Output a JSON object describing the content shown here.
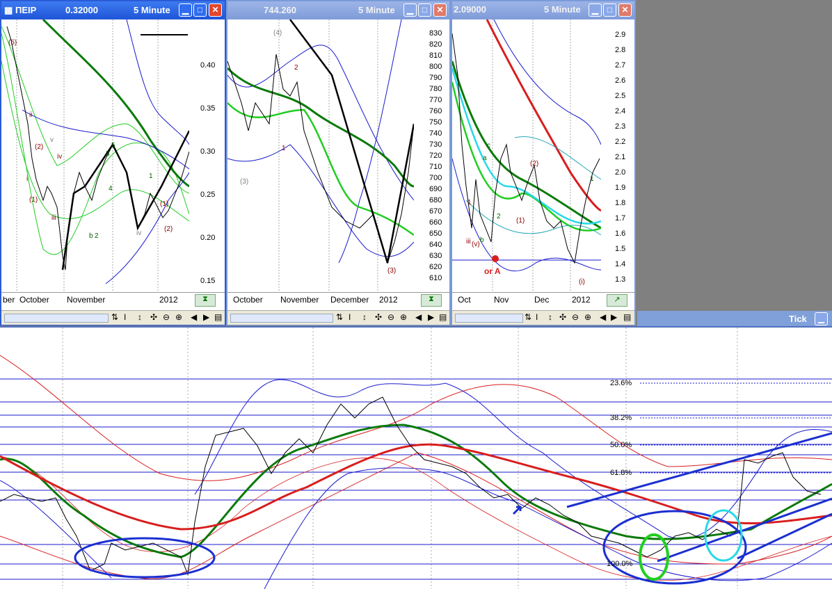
{
  "windows": [
    {
      "symbol": "ΠΕΙΡ",
      "price": "0.32000",
      "interval": "5 Minute",
      "y_ticks": [
        "0.40",
        "0.35",
        "0.30",
        "0.25",
        "0.20",
        "0.15"
      ],
      "x_labels": [
        "ber",
        "October",
        "November",
        "2012"
      ]
    },
    {
      "symbol": "",
      "price": "744.260",
      "interval": "5 Minute",
      "y_ticks": [
        "830",
        "820",
        "810",
        "800",
        "790",
        "780",
        "770",
        "760",
        "750",
        "740",
        "730",
        "720",
        "710",
        "700",
        "690",
        "680",
        "670",
        "660",
        "650",
        "640",
        "630",
        "620",
        "610"
      ],
      "x_labels": [
        "October",
        "November",
        "December",
        "2012"
      ]
    },
    {
      "symbol": "",
      "price": "2.09000",
      "interval": "5 Minute",
      "y_ticks": [
        "2.9",
        "2.8",
        "2.7",
        "2.6",
        "2.5",
        "2.4",
        "2.3",
        "2.2",
        "2.1",
        "2.0",
        "1.9",
        "1.8",
        "1.7",
        "1.6",
        "1.5",
        "1.4",
        "1.3"
      ],
      "x_labels": [
        "Oct",
        "Nov",
        "Dec",
        "2012"
      ]
    }
  ],
  "toolbar": {
    "icons": [
      "scroll-left",
      "scroll-right",
      "refresh-icon",
      "cursor-icon",
      "updown-icon",
      "move-icon",
      "zoom-out-icon",
      "zoom-in-icon",
      "prev-icon",
      "next-icon",
      "window-icon"
    ]
  },
  "tick_panel": {
    "label": "Tick"
  },
  "fib_levels": [
    "23.6%",
    "38.2%",
    "50.0%",
    "61.8%",
    "100.0%"
  ],
  "annotations": {
    "w1": [
      "(5)",
      "ii",
      "(2)",
      "iv",
      "v",
      "i",
      "(1)",
      "iii",
      "b",
      "2",
      "3",
      "4",
      "5",
      "1",
      "(1)",
      "(2)",
      "iv"
    ],
    "w2": [
      "(4)",
      "2",
      "(3)",
      "1",
      "(3)"
    ],
    "w3": [
      "c",
      "a",
      "(2)",
      "1",
      "2",
      "(1)",
      "iii",
      "(v)",
      "b",
      "or A",
      "(i)",
      "1"
    ]
  },
  "colors": {
    "title_blue": "#1f55d8",
    "ma_green": "#0a7a0a",
    "ma_red": "#d81e1e",
    "band_blue": "#1a1acc",
    "band_lightgreen": "#22cc22",
    "ellipse_blue": "#1a2fd0",
    "ellipse_green": "#1fd01f",
    "ellipse_cyan": "#28d8e8"
  }
}
